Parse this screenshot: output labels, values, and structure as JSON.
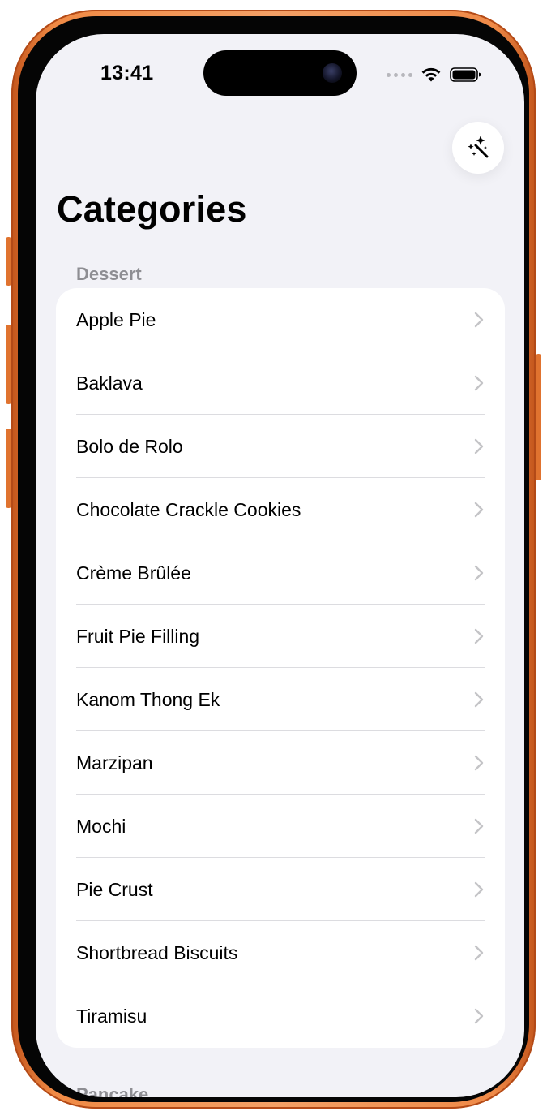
{
  "status_bar": {
    "time": "13:41"
  },
  "toolbar": {
    "magic_button_icon": "magic-wand-sparkles-icon"
  },
  "page": {
    "title": "Categories"
  },
  "sections": [
    {
      "header": "Dessert",
      "items": [
        {
          "label": "Apple Pie"
        },
        {
          "label": "Baklava"
        },
        {
          "label": "Bolo de Rolo"
        },
        {
          "label": "Chocolate Crackle Cookies"
        },
        {
          "label": "Crème Brûlée"
        },
        {
          "label": "Fruit Pie Filling"
        },
        {
          "label": "Kanom Thong Ek"
        },
        {
          "label": "Marzipan"
        },
        {
          "label": "Mochi"
        },
        {
          "label": "Pie Crust"
        },
        {
          "label": "Shortbread Biscuits"
        },
        {
          "label": "Tiramisu"
        }
      ]
    },
    {
      "header": "Pancake",
      "items": []
    }
  ],
  "colors": {
    "background": "#f2f2f7",
    "card": "#ffffff",
    "section_header": "#8e8e93",
    "chevron": "#c4c4c7",
    "phone_frame": "#f08a45"
  }
}
